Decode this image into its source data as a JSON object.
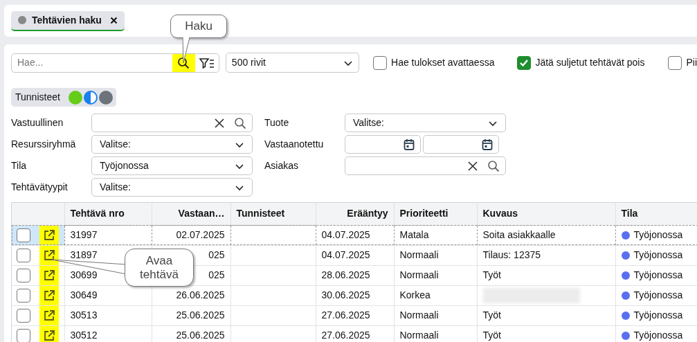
{
  "tabs": [
    {
      "label": "Tehtävien haku",
      "selected": true
    }
  ],
  "toolbar": {
    "search": {
      "placeholder": "Hae...",
      "highlighted": true
    },
    "rows_select": "500 rivit",
    "options": [
      {
        "label": "Hae tulokset avattaessa",
        "checked": false
      },
      {
        "label": "Jätä suljetut tehtävät pois",
        "checked": true
      },
      {
        "label": "Pii",
        "checked": false
      }
    ]
  },
  "tags": {
    "label": "Tunnisteet"
  },
  "filters": {
    "left": [
      {
        "label": "Vastuullinen",
        "kind": "search"
      },
      {
        "label": "Resurssiryhmä",
        "kind": "select",
        "value": "Valitse:"
      },
      {
        "label": "Tila",
        "kind": "select",
        "value": "Työjonossa"
      },
      {
        "label": "Tehtävätyypit",
        "kind": "select",
        "value": "Valitse:"
      }
    ],
    "right": [
      {
        "label": "Tuote",
        "kind": "select",
        "value": "Valitse:"
      },
      {
        "label": "Vastaanotettu",
        "kind": "date_range"
      },
      {
        "label": "Asiakas",
        "kind": "search"
      }
    ]
  },
  "table": {
    "columns": [
      "Tehtävä nro",
      "Vastaan…",
      "Tunnisteet",
      "Erääntyy",
      "Prioriteetti",
      "Kuvaus",
      "Tila"
    ],
    "open_column_highlighted": true,
    "rows": [
      {
        "selected": true,
        "checked": false,
        "nro": "31997",
        "vastaanotettu": "02.07.2025",
        "erääntyy": "04.07.2025",
        "prioriteetti": "Matala",
        "kuvaus": "Soita asiakkaalle",
        "tila": "Työjonossa",
        "color": "#5a6ff0"
      },
      {
        "selected": false,
        "checked": false,
        "nro": "31897",
        "vastaanotettu": "025",
        "erääntyy": "04.07.2025",
        "prioriteetti": "Normaali",
        "kuvaus": "Tilaus: 12375",
        "tila": "Työjonossa",
        "color": "#5a6ff0"
      },
      {
        "selected": false,
        "checked": false,
        "nro": "30699",
        "vastaanotettu": "025",
        "erääntyy": "28.06.2025",
        "prioriteetti": "Normaali",
        "kuvaus": "Työt",
        "tila": "Työjonossa",
        "color": "#5a6ff0"
      },
      {
        "selected": false,
        "checked": false,
        "nro": "30649",
        "vastaanotettu": "26.06.2025",
        "erääntyy": "30.06.2025",
        "prioriteetti": "Korkea",
        "redacted": true,
        "tila": "Työjonossa",
        "color": "#5a6ff0"
      },
      {
        "selected": false,
        "checked": false,
        "nro": "30513",
        "vastaanotettu": "25.06.2025",
        "erääntyy": "27.06.2025",
        "prioriteetti": "Normaali",
        "kuvaus": "Työt",
        "tila": "Työjonossa",
        "color": "#5a6ff0"
      },
      {
        "selected": false,
        "checked": false,
        "nro": "30512",
        "vastaanotettu": "25.06.2025",
        "erääntyy": "27.06.2025",
        "prioriteetti": "Normaali",
        "kuvaus": "Työt",
        "tila": "Työjonossa",
        "color": "#5a6ff0"
      }
    ]
  },
  "callouts": [
    {
      "text": "Haku"
    },
    {
      "text": "Avaa tehtävä"
    }
  ]
}
